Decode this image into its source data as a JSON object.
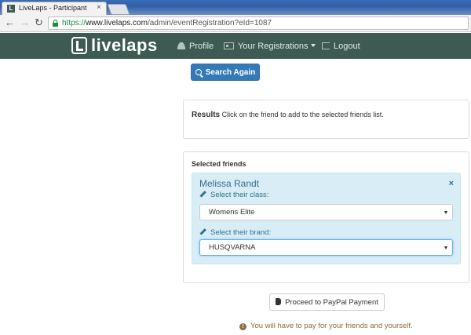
{
  "browser": {
    "tab_title": "LiveLaps - Participant",
    "tab_close": "×",
    "url_protocol": "https://",
    "url_host": "www.livelaps.com",
    "url_path": "/admin/eventRegistration?eId=1087",
    "icons": {
      "back": "arrow-left-icon",
      "forward": "arrow-right-icon",
      "reload": "reload-icon"
    }
  },
  "nav": {
    "logo_text": "livelaps",
    "profile": "Profile",
    "registrations": "Your Registrations",
    "logout": "Logout"
  },
  "search": {
    "button_label": "Search Again"
  },
  "results": {
    "heading": "Results",
    "hint": "Click on the friend to add to the selected friends list."
  },
  "selected": {
    "heading": "Selected friends",
    "friend": {
      "name": "Melissa Randt",
      "remove": "×",
      "class_label": "Select their class:",
      "class_value": "Womens Elite",
      "brand_label": "Select their brand:",
      "brand_value": "HUSQVARNA"
    }
  },
  "payment": {
    "button_label": "Proceed to PayPal Payment",
    "notice": "You will have to pay for your friends and yourself."
  },
  "colors": {
    "nav_bg": "#3d5b52",
    "primary": "#337ab7",
    "info_bg": "#d9edf7",
    "info_text": "#31708f",
    "warning_text": "#8a6d3b"
  }
}
